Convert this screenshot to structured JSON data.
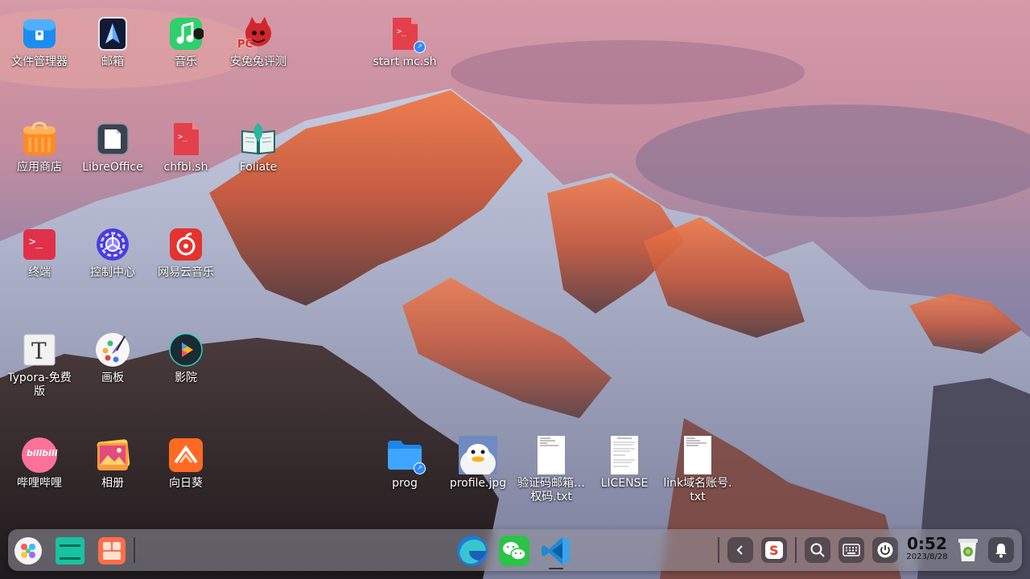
{
  "desktop_icons": [
    {
      "label": "文件管理器",
      "icon": "file-manager-icon"
    },
    {
      "label": "邮箱",
      "icon": "mail-icon"
    },
    {
      "label": "音乐",
      "icon": "music-icon"
    },
    {
      "label": "安兔兔评测",
      "icon": "antutu-icon",
      "badge": "PC"
    },
    {
      "label": "start mc.sh",
      "icon": "shell-script-icon"
    },
    {
      "label": "应用商店",
      "icon": "app-store-icon"
    },
    {
      "label": "LibreOffice",
      "icon": "libreoffice-icon"
    },
    {
      "label": "chfbl.sh",
      "icon": "shell-script-icon"
    },
    {
      "label": "Foliate",
      "icon": "foliate-book-icon"
    },
    {
      "label": "终端",
      "icon": "terminal-icon"
    },
    {
      "label": "控制中心",
      "icon": "control-center-icon"
    },
    {
      "label": "网易云音乐",
      "icon": "netease-music-icon"
    },
    {
      "label": "Typora-免费版",
      "icon": "typora-icon"
    },
    {
      "label": "画板",
      "icon": "draw-palette-icon"
    },
    {
      "label": "影院",
      "icon": "movie-player-icon"
    },
    {
      "label": "哔哩哔哩",
      "icon": "bilibili-icon",
      "badge": "bilibili"
    },
    {
      "label": "相册",
      "icon": "album-icon"
    },
    {
      "label": "向日葵",
      "icon": "sunlogin-icon"
    },
    {
      "label": "prog",
      "icon": "folder-icon"
    },
    {
      "label": "profile.jpg",
      "icon": "image-thumbnail-icon"
    },
    {
      "label": "验证码邮箱…权码.txt",
      "icon": "text-file-icon"
    },
    {
      "label": "LICENSE",
      "icon": "text-file-icon"
    },
    {
      "label": "link域名账号.txt",
      "icon": "text-file-icon"
    }
  ],
  "taskbar": {
    "left_apps": [
      "launcher-icon",
      "multitask-view-icon",
      "app-grid-icon"
    ],
    "center_apps": [
      "edge-browser-icon",
      "wechat-icon",
      "vscode-icon"
    ],
    "tray": [
      "collapse-tray-icon",
      "sogou-input-icon",
      "search-icon",
      "keyboard-icon",
      "power-icon"
    ],
    "clock_time": "0:52",
    "clock_date": "2023/8/28",
    "trash": "trash-icon",
    "notifications": "bell-icon"
  },
  "colors": {
    "terminal_red": "#e0424f",
    "folder_blue": "#2f9bff",
    "vscode_blue": "#1f8ad2"
  }
}
